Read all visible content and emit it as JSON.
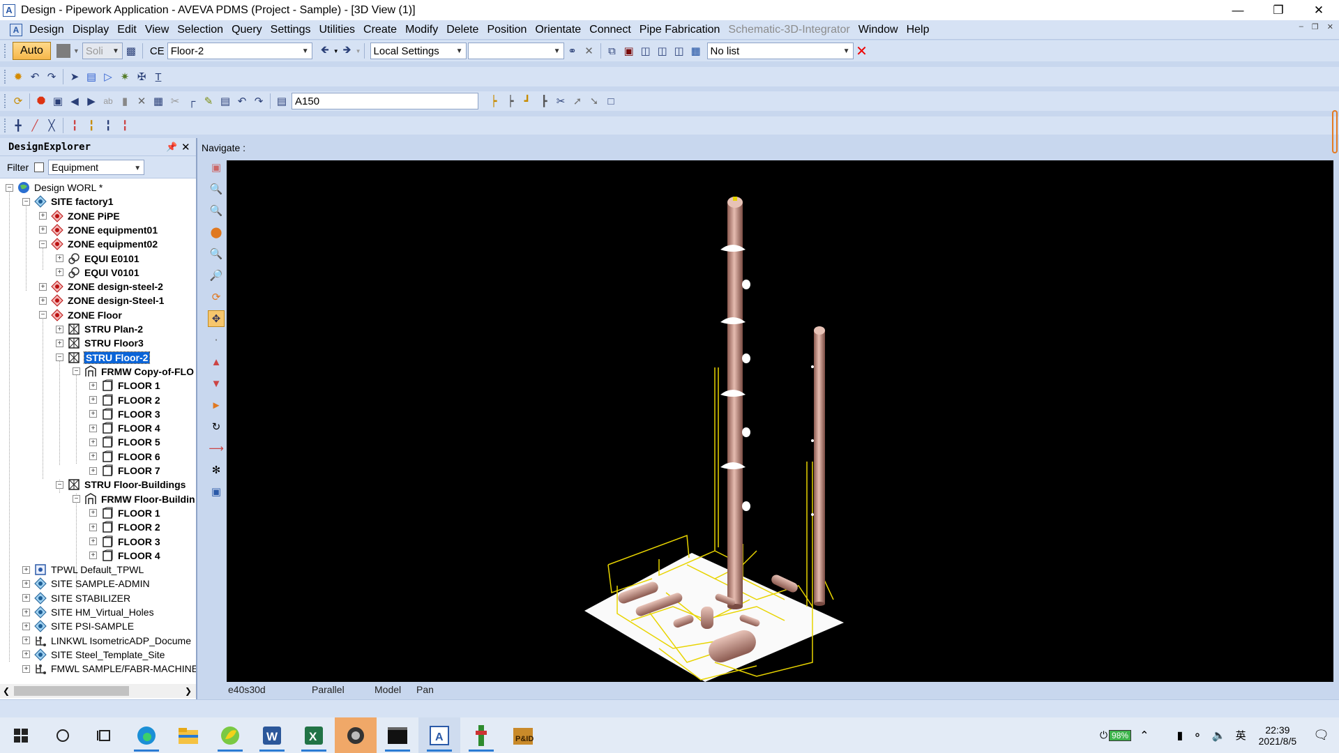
{
  "window": {
    "title": "Design - Pipework Application - AVEVA PDMS (Project - Sample) - [3D View (1)]",
    "app_icon": "A"
  },
  "menu": [
    "Design",
    "Display",
    "Edit",
    "View",
    "Selection",
    "Query",
    "Settings",
    "Utilities",
    "Create",
    "Modify",
    "Delete",
    "Position",
    "Orientate",
    "Connect",
    "Pipe Fabrication",
    "Schematic-3D-Integrator",
    "Window",
    "Help"
  ],
  "menu_disabled": [
    "Schematic-3D-Integrator"
  ],
  "toolbar1": {
    "auto_label": "Auto",
    "solid_label": "Soli",
    "ce_label": "CE",
    "ce_value": "Floor-2",
    "settings_value": "Local Settings",
    "settings2_value": "",
    "list_value": "No list"
  },
  "toolbar3": {
    "spec_value": "A150"
  },
  "explorer": {
    "title": "DesignExplorer",
    "filter_label": "Filter",
    "filter_value": "Equipment",
    "tree": [
      {
        "label": "Design WORL *",
        "indent": 0,
        "exp": "-",
        "icon": "globe",
        "bold": false
      },
      {
        "label": "SITE factory1",
        "indent": 1,
        "exp": "-",
        "icon": "site",
        "bold": true
      },
      {
        "label": "ZONE PiPE",
        "indent": 2,
        "exp": "+",
        "icon": "zone",
        "bold": true
      },
      {
        "label": "ZONE equipment01",
        "indent": 2,
        "exp": "+",
        "icon": "zone",
        "bold": true
      },
      {
        "label": "ZONE equipment02",
        "indent": 2,
        "exp": "-",
        "icon": "zone",
        "bold": true
      },
      {
        "label": "EQUI E0101",
        "indent": 3,
        "exp": "+",
        "icon": "equi",
        "bold": true
      },
      {
        "label": "EQUI V0101",
        "indent": 3,
        "exp": "+",
        "icon": "equi",
        "bold": true
      },
      {
        "label": "ZONE design-steel-2",
        "indent": 2,
        "exp": "+",
        "icon": "zone",
        "bold": true
      },
      {
        "label": "ZONE design-Steel-1",
        "indent": 2,
        "exp": "+",
        "icon": "zone",
        "bold": true
      },
      {
        "label": "ZONE Floor",
        "indent": 2,
        "exp": "-",
        "icon": "zone",
        "bold": true
      },
      {
        "label": "STRU Plan-2",
        "indent": 3,
        "exp": "+",
        "icon": "stru",
        "bold": true
      },
      {
        "label": "STRU Floor3",
        "indent": 3,
        "exp": "+",
        "icon": "stru",
        "bold": true
      },
      {
        "label": "STRU Floor-2",
        "indent": 3,
        "exp": "-",
        "icon": "stru",
        "bold": true,
        "selected": true
      },
      {
        "label": "FRMW Copy-of-FLO",
        "indent": 4,
        "exp": "-",
        "icon": "frmw",
        "bold": true
      },
      {
        "label": "FLOOR 1",
        "indent": 5,
        "exp": "+",
        "icon": "floor",
        "bold": true
      },
      {
        "label": "FLOOR 2",
        "indent": 5,
        "exp": "+",
        "icon": "floor",
        "bold": true
      },
      {
        "label": "FLOOR 3",
        "indent": 5,
        "exp": "+",
        "icon": "floor",
        "bold": true
      },
      {
        "label": "FLOOR 4",
        "indent": 5,
        "exp": "+",
        "icon": "floor",
        "bold": true
      },
      {
        "label": "FLOOR 5",
        "indent": 5,
        "exp": "+",
        "icon": "floor",
        "bold": true
      },
      {
        "label": "FLOOR 6",
        "indent": 5,
        "exp": "+",
        "icon": "floor",
        "bold": true
      },
      {
        "label": "FLOOR 7",
        "indent": 5,
        "exp": "+",
        "icon": "floor",
        "bold": true
      },
      {
        "label": "STRU Floor-Buildings",
        "indent": 3,
        "exp": "-",
        "icon": "stru",
        "bold": true
      },
      {
        "label": "FRMW Floor-Buildin",
        "indent": 4,
        "exp": "-",
        "icon": "frmw",
        "bold": true
      },
      {
        "label": "FLOOR 1",
        "indent": 5,
        "exp": "+",
        "icon": "floor",
        "bold": true
      },
      {
        "label": "FLOOR 2",
        "indent": 5,
        "exp": "+",
        "icon": "floor",
        "bold": true
      },
      {
        "label": "FLOOR 3",
        "indent": 5,
        "exp": "+",
        "icon": "floor",
        "bold": true
      },
      {
        "label": "FLOOR 4",
        "indent": 5,
        "exp": "+",
        "icon": "floor",
        "bold": true
      },
      {
        "label": "TPWL Default_TPWL",
        "indent": 1,
        "exp": "+",
        "icon": "tpwl",
        "bold": false
      },
      {
        "label": "SITE SAMPLE-ADMIN",
        "indent": 1,
        "exp": "+",
        "icon": "site",
        "bold": false
      },
      {
        "label": "SITE STABILIZER",
        "indent": 1,
        "exp": "+",
        "icon": "site",
        "bold": false
      },
      {
        "label": "SITE HM_Virtual_Holes",
        "indent": 1,
        "exp": "+",
        "icon": "site",
        "bold": false
      },
      {
        "label": "SITE PSI-SAMPLE",
        "indent": 1,
        "exp": "+",
        "icon": "site",
        "bold": false
      },
      {
        "label": "LINKWL IsometricADP_Docume",
        "indent": 1,
        "exp": "+",
        "icon": "link",
        "bold": false
      },
      {
        "label": "SITE Steel_Template_Site",
        "indent": 1,
        "exp": "+",
        "icon": "site",
        "bold": false
      },
      {
        "label": "FMWL SAMPLE/FABR-MACHINE",
        "indent": 1,
        "exp": "+",
        "icon": "link",
        "bold": false
      }
    ]
  },
  "view": {
    "navigate_label": "Navigate :",
    "status": [
      "e40s30d",
      "Parallel",
      "Model",
      "Pan"
    ]
  },
  "taskbar": {
    "battery": "98%",
    "ime": "英",
    "time": "22:39",
    "date": "2021/8/5"
  }
}
